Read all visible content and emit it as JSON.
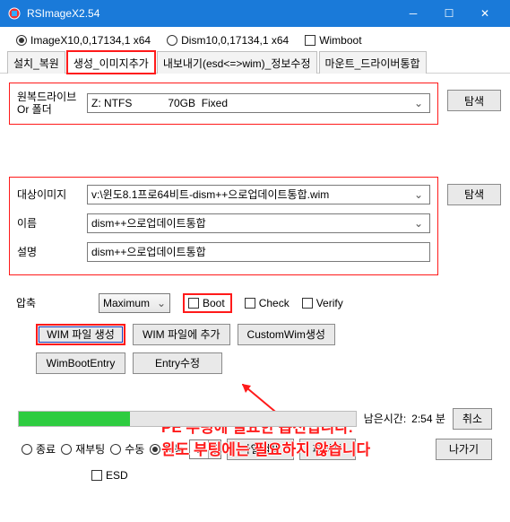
{
  "window": {
    "title": "RSImageX2.54",
    "icon": "app-icon"
  },
  "top_options": {
    "radio1": "ImageX10,0,17134,1 x64",
    "radio1_selected": true,
    "radio2": "Dism10,0,17134,1 x64",
    "radio2_selected": false,
    "wimboot": "Wimboot",
    "wimboot_checked": false
  },
  "tabs": [
    {
      "label": "설치_복원",
      "active": false
    },
    {
      "label": "생성_이미지추가",
      "active": true
    },
    {
      "label": "내보내기(esd<=>wim)_정보수정",
      "active": false
    },
    {
      "label": "마운트_드라이버통합",
      "active": false
    }
  ],
  "group1": {
    "drive_label": "원복드라이브\nOr 폴더",
    "drive_value": "Z: NTFS            70GB  Fixed",
    "browse": "탐색"
  },
  "group2": {
    "target_label": "대상이미지",
    "target_value": "v:\\윈도8.1프로64비트-dism++으로업데이트통합.wim",
    "name_label": "이름",
    "name_value": "dism++으로업데이트통합",
    "desc_label": "설명",
    "desc_value": "dism++으로업데이트통합",
    "browse": "탐색"
  },
  "opts": {
    "compress_label": "압축",
    "compress_value": "Maximum",
    "boot": "Boot",
    "boot_checked": false,
    "check": "Check",
    "check_checked": false,
    "verify": "Verify",
    "verify_checked": false
  },
  "buttons1": {
    "create_wim": "WIM 파일 생성",
    "append_wim": "WIM 파일에 추가",
    "custom_wim": "CustomWim생성"
  },
  "buttons2": {
    "wimboot_entry": "WimBootEntry",
    "entry_mod": "Entry수정"
  },
  "annotation": {
    "line1": "PE 부팅에 필요한 옵션입니다.",
    "line2": "윈도 부팅에는 필요하지 않습니다"
  },
  "progress": {
    "percent": 33,
    "remain_label": "남은시간:",
    "remain_value": "2:54 분",
    "cancel": "취소"
  },
  "bottom": {
    "radios": [
      {
        "label": "종료",
        "sel": false
      },
      {
        "label": "재부팅",
        "sel": false
      },
      {
        "label": "수동",
        "sel": false
      },
      {
        "label": "자동",
        "sel": true
      }
    ],
    "spin_value": "1",
    "file_search": "파일검색",
    "partition": "파티션",
    "exit": "나가기",
    "esd": "ESD",
    "esd_checked": false
  }
}
